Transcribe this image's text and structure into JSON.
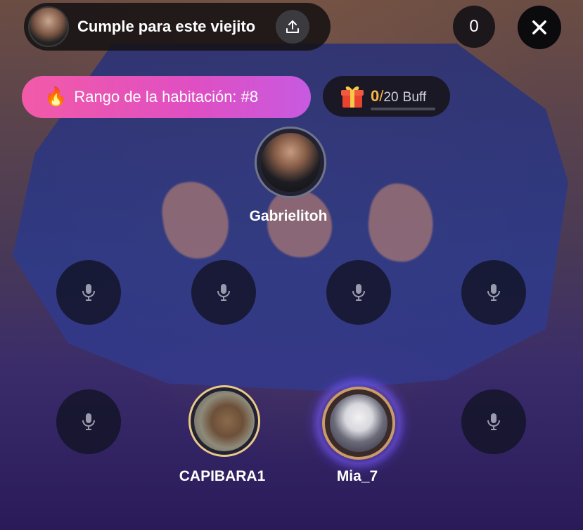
{
  "room": {
    "title": "Cumple para este viejito",
    "viewer_count": "0"
  },
  "rank": {
    "emoji": "🔥",
    "label": "Rango de la habitación: #8"
  },
  "buff": {
    "current": "0",
    "separator": "/",
    "max": "20",
    "label": "Buff",
    "progress_fraction": 0
  },
  "seats": {
    "host": {
      "name": "Gabrielitoh"
    },
    "row2": [
      {
        "state": "empty",
        "icon": "microphone-icon"
      },
      {
        "state": "empty",
        "icon": "microphone-icon"
      },
      {
        "state": "empty",
        "icon": "microphone-icon"
      },
      {
        "state": "empty",
        "icon": "microphone-icon"
      }
    ],
    "row3_left": {
      "state": "empty",
      "icon": "microphone-icon"
    },
    "capibara": {
      "name": "CAPIBARA1"
    },
    "mia": {
      "name": "Mia_7"
    },
    "row3_right": {
      "state": "empty",
      "icon": "microphone-icon"
    }
  },
  "icons": {
    "share": "share-icon",
    "close": "close-icon",
    "gift": "gift-icon"
  },
  "colors": {
    "rank_gradient_start": "#f25aa8",
    "rank_gradient_end": "#c75ae0",
    "buff_accent": "#f5b944",
    "speaking_glow": "#785aff"
  }
}
